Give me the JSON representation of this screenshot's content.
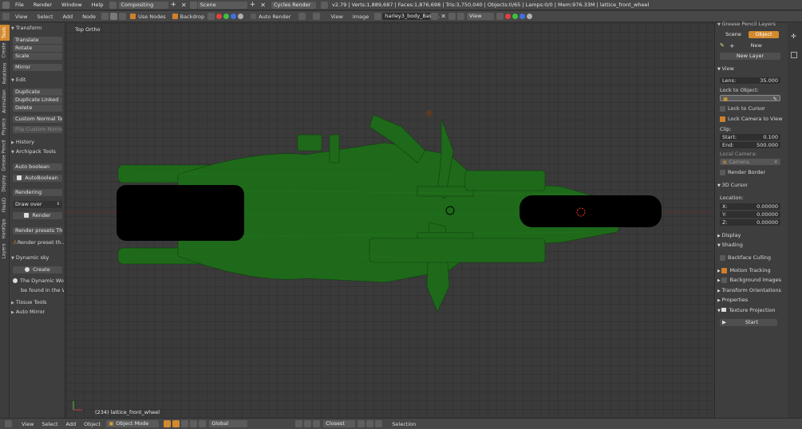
{
  "info_header": {
    "menus": [
      "File",
      "Render",
      "Window",
      "Help"
    ],
    "screen_layout": "Compositing",
    "scene": "Scene",
    "engine": "Cycles Render",
    "stats": "v2.79 | Verts:1,889,687 | Faces:1,876,698 | Tris:3,750,040 | Objects:0/65 | Lamps:0/0 | Mem:976.33M | lattice_front_wheel"
  },
  "node_header": {
    "menus": [
      "View",
      "Select",
      "Add",
      "Node"
    ],
    "use_nodes": "Use Nodes",
    "backdrop": "Backdrop",
    "auto_render": "Auto Render"
  },
  "image_header": {
    "menus": [
      "View",
      "Image"
    ],
    "image_name": "harley3_body_Base...",
    "view": "View"
  },
  "left_tabs": [
    "Tools",
    "Create",
    "Relations",
    "Animation",
    "Physics",
    "Grease Pencil",
    "Display",
    "FileUD",
    "HardOps",
    "Layers"
  ],
  "tools": {
    "transform": "Transform",
    "translate": "Translate",
    "rotate": "Rotate",
    "scale": "Scale",
    "mirror": "Mirror",
    "edit": "Edit",
    "duplicate": "Duplicate",
    "duplicate_linked": "Duplicate Linked",
    "delete": "Delete",
    "custom_normal_tools": "Custom Normal Tools",
    "flip_custom_normals": "Flip Custom Normals",
    "history": "History",
    "archipack": "Archipack Tools",
    "auto_boolean": "Auto boolean",
    "autoboolean_btn": "AutoBoolean",
    "rendering": "Rendering",
    "draw_over": "Draw over",
    "render": "Render",
    "render_presets": "Render presets Thu...",
    "render_presets_warn": "Render preset th...",
    "dynamic_sky": "Dynamic sky",
    "create": "Create",
    "dyn_info1": "The Dynamic Worl",
    "dyn_info2": "be found in the Wo",
    "tissue_tools": "Tissue Tools",
    "auto_mirror": "Auto Mirror"
  },
  "viewport": {
    "view_label": "Top Ortho",
    "object_label": "(234) lattice_front_wheel"
  },
  "properties": {
    "grease_layers": "Grease Pencil Layers",
    "scene_tab": "Scene",
    "object_tab": "Object",
    "new": "New",
    "new_layer": "New Layer",
    "view": "View",
    "lens_label": "Lens:",
    "lens_value": "35.000",
    "lock_to_object": "Lock to Object:",
    "lock_to_cursor": "Lock to Cursor",
    "lock_camera": "Lock Camera to View",
    "clip": "Clip:",
    "start_label": "Start:",
    "start_value": "0.100",
    "end_label": "End:",
    "end_value": "500.000",
    "local_camera": "Local Camera:",
    "camera": "Camera",
    "render_border": "Render Border",
    "cursor_3d": "3D Cursor",
    "location": "Location:",
    "x_label": "X:",
    "x_value": "0.00000",
    "y_label": "Y:",
    "y_value": "0.00000",
    "z_label": "Z:",
    "z_value": "0.00000",
    "display": "Display",
    "shading": "Shading",
    "backface": "Backface Culling",
    "motion_tracking": "Motion Tracking",
    "background_images": "Background Images",
    "transform_orientations": "Transform Orientations",
    "properties": "Properties",
    "texture_projection": "Texture Projection",
    "start_btn": "Start"
  },
  "bottom": {
    "menus": [
      "View",
      "Select",
      "Add",
      "Object"
    ],
    "mode": "Object Mode",
    "orientation": "Global",
    "snap": "Closest",
    "selection": "Selection"
  },
  "colors": {
    "accent": "#d38a2e",
    "mesh": "#1e6a1a",
    "wheel": "#000000",
    "cursor": "#ff3a1a"
  }
}
